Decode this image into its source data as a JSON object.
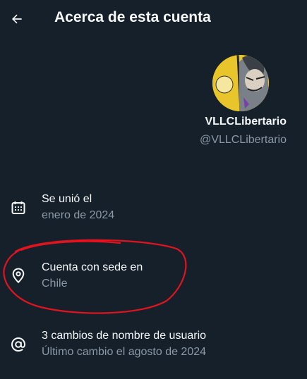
{
  "header": {
    "back_icon": "arrow-left-icon",
    "title": "Acerca de esta cuenta"
  },
  "profile": {
    "avatar_icon": "profile-avatar-cartoon",
    "display_name": "VLLCLibertario",
    "handle": "@VLLCLibertario"
  },
  "info": [
    {
      "icon": "calendar-icon",
      "label": "Se unió el",
      "value": "enero de 2024"
    },
    {
      "icon": "location-pin-icon",
      "label": "Cuenta con sede en",
      "value": "Chile"
    },
    {
      "icon": "at-sign-icon",
      "label": "3 cambios de nombre de usuario",
      "value": "Último cambio el agosto de 2024"
    }
  ],
  "colors": {
    "background": "#15202b",
    "primary_text": "#f7f9f9",
    "secondary_text": "#8b98a5",
    "annotation": "#e0141e"
  }
}
